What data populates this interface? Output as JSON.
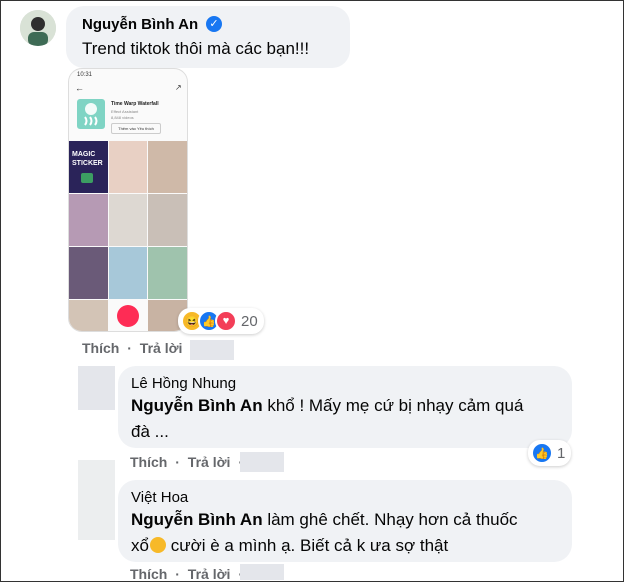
{
  "post": {
    "author": "Nguyễn Bình An",
    "verified_icon": "verified-badge-icon",
    "text": "Trend tiktok thôi mà các bạn!!!",
    "attachment": {
      "status_time": "10:31",
      "sound_title": "Time Warp Waterfall",
      "sound_sub1": "Effect Assistant",
      "sound_sub2": "8,848 videos",
      "save_label": "Thêm vào Yêu thích",
      "magic_line1": "MAGIC",
      "magic_line2": "STICKER"
    },
    "reactions": {
      "icons": [
        "haha-icon",
        "like-icon",
        "love-icon"
      ],
      "count": "20"
    },
    "actions": {
      "like": "Thích",
      "reply": "Trả lời"
    }
  },
  "replies": [
    {
      "author": "Lê Hồng Nhung",
      "tag": "Nguyễn Bình An",
      "text_line1": " khổ ! Mấy mẹ cứ bị nhạy cảm quá",
      "text_line2": "đà ...",
      "reactions": {
        "icons": [
          "like-icon"
        ],
        "count": "1"
      },
      "actions": {
        "like": "Thích",
        "reply": "Trả lời"
      }
    },
    {
      "author": "Việt Hoa",
      "tag": "Nguyễn Bình An",
      "text_line1": " làm ghê chết. Nhạy hơn cả thuốc",
      "text_line2_a": "xổ",
      "emoji": "rofl-emoji",
      "text_line2_b": " cười è a mình ạ. Biết cả k ưa sợ thật",
      "actions": {
        "like": "Thích",
        "reply": "Trả lời"
      }
    }
  ],
  "colors": {
    "bubble": "#f0f2f5",
    "name": "#050505",
    "action_gray": "#65676b",
    "like_blue": "#1877f2",
    "love_red": "#f33e58",
    "haha_yellow": "#f7b928"
  }
}
